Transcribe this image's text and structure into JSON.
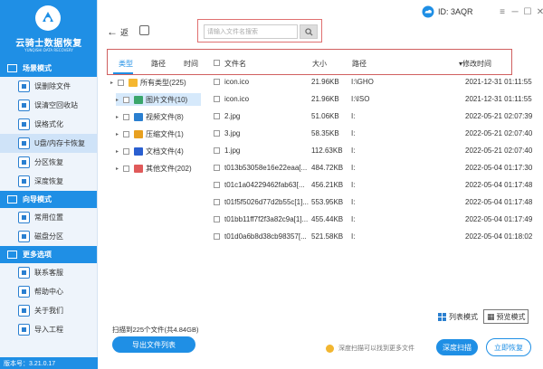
{
  "app": {
    "title": "云骑士数据恢复",
    "subtitle": "YUNQISHI DATA RECOVERY",
    "version": "版本号：3.21.0.17",
    "id_label": "ID: 3AQR"
  },
  "sidebar": {
    "sections": [
      {
        "title": "场景模式",
        "items": [
          "误删除文件",
          "误清空回收站",
          "误格式化",
          "U盘/内存卡恢复",
          "分区恢复",
          "深度恢复"
        ]
      },
      {
        "title": "向导模式",
        "items": [
          "常用位置",
          "磁盘分区"
        ]
      },
      {
        "title": "更多选项",
        "items": [
          "联系客服",
          "帮助中心",
          "关于我们",
          "导入工程"
        ]
      }
    ]
  },
  "toolbar": {
    "back_label": "返",
    "search_placeholder": "请输入文件名搜索"
  },
  "tabs": {
    "type": "类型",
    "path": "路径",
    "time": "时间"
  },
  "columns": {
    "name": "文件名",
    "size": "大小",
    "path": "路径",
    "modified": "修改时间"
  },
  "tree": [
    {
      "label": "所有类型(225)",
      "color": "#f5b731"
    },
    {
      "label": "图片文件(10)",
      "color": "#3aa66b"
    },
    {
      "label": "视频文件(8)",
      "color": "#2a7fd0"
    },
    {
      "label": "压缩文件(1)",
      "color": "#e8a020"
    },
    {
      "label": "文档文件(4)",
      "color": "#2a5fd0"
    },
    {
      "label": "其他文件(202)",
      "color": "#e05a5a"
    }
  ],
  "files": [
    {
      "name": "icon.ico",
      "size": "21.96KB",
      "path": "I:\\GHO",
      "time": "2021-12-31 01:11:55"
    },
    {
      "name": "icon.ico",
      "size": "21.96KB",
      "path": "I:\\ISO",
      "time": "2021-12-31 01:11:55"
    },
    {
      "name": "2.jpg",
      "size": "51.06KB",
      "path": "I:",
      "time": "2022-05-21 02:07:39"
    },
    {
      "name": "3.jpg",
      "size": "58.35KB",
      "path": "I:",
      "time": "2022-05-21 02:07:40"
    },
    {
      "name": "1.jpg",
      "size": "112.63KB",
      "path": "I:",
      "time": "2022-05-21 02:07:40"
    },
    {
      "name": "t013b53058e16e22eaa[...",
      "size": "484.72KB",
      "path": "I:",
      "time": "2022-05-04 01:17:30"
    },
    {
      "name": "t01c1a04229462fab63[...",
      "size": "456.21KB",
      "path": "I:",
      "time": "2022-05-04 01:17:48"
    },
    {
      "name": "t01f5f5026d77d2b55c[1]...",
      "size": "553.95KB",
      "path": "I:",
      "time": "2022-05-04 01:17:48"
    },
    {
      "name": "t01bb11ff7f2f3a82c9a[1]...",
      "size": "455.44KB",
      "path": "I:",
      "time": "2022-05-04 01:17:49"
    },
    {
      "name": "t01d0a6b8d38cb98357[...",
      "size": "521.58KB",
      "path": "I:",
      "time": "2022-05-04 01:18:02"
    }
  ],
  "bottom": {
    "scan_info": "扫描到225个文件(共4.84GB)",
    "export_label": "导出文件列表",
    "list_view": "列表模式",
    "preview_view": "预览模式",
    "tip": "深度扫描可以找到更多文件",
    "deep_scan": "深度扫描",
    "recover": "立即恢复"
  },
  "colors": {
    "accent": "#1f8fe5",
    "highlight_border": "#d06060"
  }
}
